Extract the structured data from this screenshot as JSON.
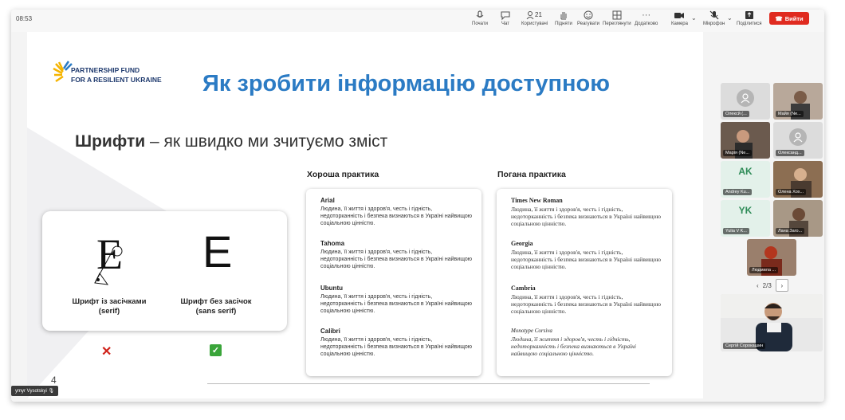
{
  "clock": "08:53",
  "toolbar": {
    "items": [
      {
        "label": "Почати",
        "icon": "mic-stage-icon"
      },
      {
        "label": "Чат",
        "icon": "chat-icon"
      },
      {
        "label": "Користувачі",
        "icon": "participants-icon",
        "count": "21"
      },
      {
        "label": "Підняти",
        "icon": "raise-hand-icon"
      },
      {
        "label": "Реагувати",
        "icon": "react-icon"
      },
      {
        "label": "Переглянути",
        "icon": "view-icon"
      },
      {
        "label": "Додатково",
        "icon": "more-icon"
      },
      {
        "label": "Камера",
        "icon": "camera-icon"
      },
      {
        "label": "Мікрофон",
        "icon": "mic-icon"
      },
      {
        "label": "Поділитися",
        "icon": "share-icon"
      }
    ],
    "leave_label": "Вийти",
    "leave_color": "#e02b20"
  },
  "slide": {
    "logo_line1": "PARTNERSHIP FUND",
    "logo_line2": "FOR A RESILIENT UKRAINE",
    "title": "Як зробити інформацію доступною",
    "subtitle_bold": "Шрифти",
    "subtitle_rest": " – як швидко ми зчитуємо зміст",
    "serif_glyph": "E",
    "sans_glyph": "E",
    "serif_label_1": "Шрифт із засічками",
    "serif_label_2": "(serif)",
    "sans_label_1": "Шрифт без засічок",
    "sans_label_2": "(sans serif)",
    "bad_mark": "✕",
    "good_mark": "✓",
    "good_heading": "Хороша практика",
    "bad_heading": "Погана практика",
    "good_fonts": [
      {
        "name": "Arial",
        "text": "Людина, її життя і здоров'я, честь і гідність, недоторканність і безпека визнаються в Україні найвищою соціальною цінністю."
      },
      {
        "name": "Tahoma",
        "text": "Людина, її життя і здоров'я, честь і гідність, недоторканність і безпека визнаються в Україні найвищою соціальною цінністю."
      },
      {
        "name": "Ubuntu",
        "text": "Людина, її життя і здоров'я, честь і гідність, недоторканність і безпека визнаються в Україні найвищою соціальною цінністю."
      },
      {
        "name": "Calibri",
        "text": "Людина, її життя і здоров'я, честь і гідність, недоторканність і безпека визнаються в Україні найвищою соціальною цінністю."
      }
    ],
    "bad_fonts": [
      {
        "name": "Times New Roman",
        "text": "Людина, її життя і здоров'я, честь і гідність, недоторканність і безпека визнаються в Україні найвищою соціальною цінністю."
      },
      {
        "name": "Georgia",
        "text": "Людина, її життя і здоров'я, честь і гідність, недоторканність і безпека визнаються в Україні найвищою соціальною цінністю."
      },
      {
        "name": "Cambria",
        "text": "Людина, її життя і здоров'я, честь і гідність, недоторканність і безпека визнаються в Україні найвищою соціальною цінністю."
      },
      {
        "name": "Monotype Corsiva",
        "text": "Людина, її життя і здоров'я, честь і гідність, недоторканність і безпека визнаються в Україні найвищою соціальною цінністю."
      }
    ],
    "page_number": "4"
  },
  "active_speaker": "ymyr Vysotskyi",
  "participants": [
    {
      "name": "Олексй (...",
      "initials": "",
      "bg": "#dcdcdc"
    },
    {
      "name": "Майя (Ne...",
      "initials": "",
      "bg": "#b8a89a"
    },
    {
      "name": "Марія (Ne...",
      "initials": "",
      "bg": "#6b5a4e"
    },
    {
      "name": "Олександ...",
      "initials": "",
      "bg": "#dcdcdc"
    },
    {
      "name": "Andrey Ku...",
      "initials": "AK",
      "bg": "#e3f1ea"
    },
    {
      "name": "Олена Хох...",
      "initials": "",
      "bg": "#8c6e52"
    },
    {
      "name": "Yulia V K...",
      "initials": "YK",
      "bg": "#e3f1ea"
    },
    {
      "name": "Лана Заго...",
      "initials": "",
      "bg": "#a89886"
    },
    {
      "name": "Людмила ...",
      "initials": "",
      "bg": "#9a7f6c"
    }
  ],
  "pager": {
    "text": "2/3",
    "prev": "‹",
    "next": "›"
  },
  "main_video_name": "Сергій Сорокашин",
  "initials_color": "#2e8b57"
}
